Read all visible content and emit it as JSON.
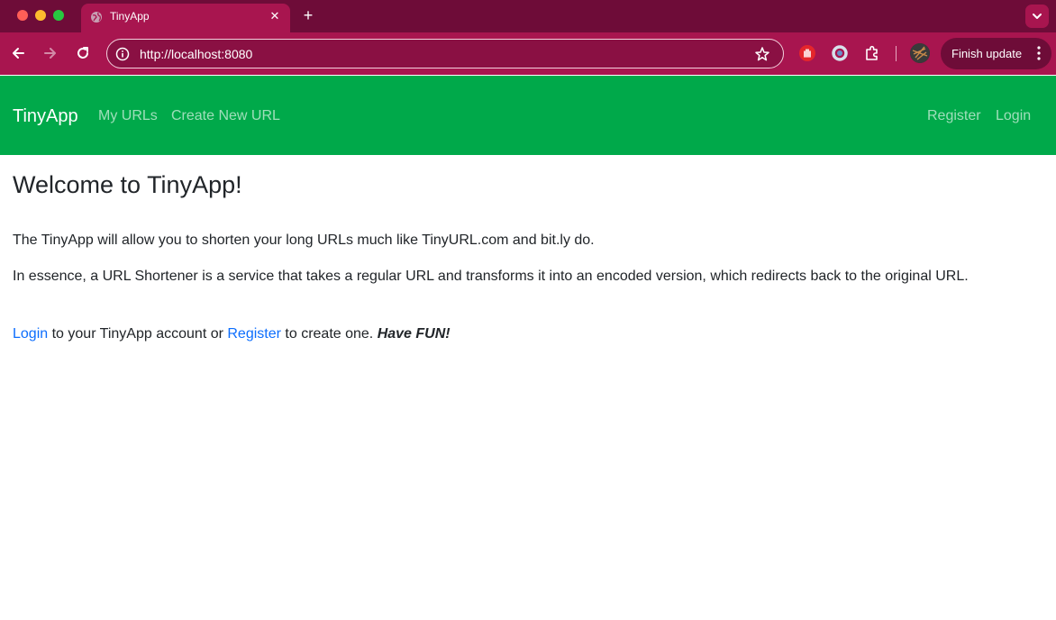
{
  "browser": {
    "tab_title": "TinyApp",
    "url": "http://localhost:8080",
    "finish_update_label": "Finish update",
    "colors": {
      "frame": "#6e0c38",
      "toolbar": "#a8154f"
    },
    "icons": [
      "globe-icon",
      "close-icon",
      "plus-icon",
      "chevron-down-icon",
      "back-arrow-icon",
      "forward-arrow-icon",
      "reload-icon",
      "info-icon",
      "star-icon",
      "hand-extension-icon",
      "ring-extension-icon",
      "puzzle-icon",
      "avatar",
      "more-vertical-icon"
    ]
  },
  "navbar": {
    "brand": "TinyApp",
    "links": [
      {
        "label": "My URLs"
      },
      {
        "label": "Create New URL"
      },
      {
        "label": "Register"
      },
      {
        "label": "Login"
      }
    ],
    "colors": {
      "background": "#00a94a"
    }
  },
  "main": {
    "heading": "Welcome to TinyApp!",
    "paragraphs": [
      "The TinyApp will allow you to shorten your long URLs much like TinyURL.com and bit.ly do.",
      "In essence, a URL Shortener is a service that takes a regular URL and transforms it into an encoded version, which redirects back to the original URL."
    ],
    "cta": {
      "login_link": "Login",
      "text_1": " to your TinyApp account or ",
      "register_link": "Register",
      "text_2": " to create one. ",
      "emphasis": "Have FUN!"
    },
    "colors": {
      "link": "#0d6efd"
    }
  }
}
